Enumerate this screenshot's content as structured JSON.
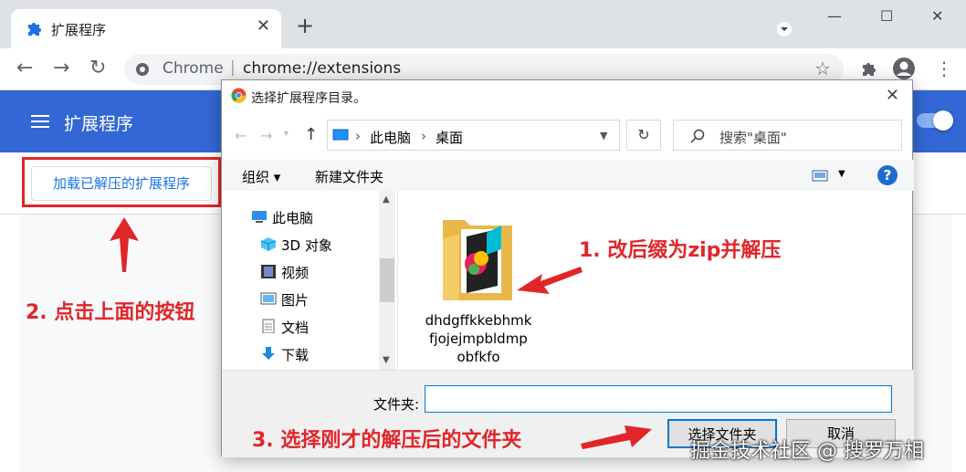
{
  "browser": {
    "tab_title": "扩展程序",
    "omnibox_site": "Chrome",
    "omnibox_url": "chrome://extensions"
  },
  "page": {
    "header_title": "扩展程序",
    "load_unpacked_label": "加载已解压的扩展程序"
  },
  "annotations": {
    "step1": "1. 改后缀为zip并解压",
    "step2": "2. 点击上面的按钮",
    "step3": "3. 选择刚才的解压后的文件夹",
    "color": "#e0262a"
  },
  "dialog": {
    "title": "选择扩展程序目录。",
    "breadcrumb": [
      "此电脑",
      "桌面"
    ],
    "search_placeholder": "搜索\"桌面\"",
    "commands": {
      "organize": "组织",
      "new_folder": "新建文件夹"
    },
    "nav_items": [
      {
        "label": "此电脑",
        "icon": "computer-icon"
      },
      {
        "label": "3D 对象",
        "icon": "cube-icon"
      },
      {
        "label": "视频",
        "icon": "film-icon"
      },
      {
        "label": "图片",
        "icon": "picture-icon"
      },
      {
        "label": "文档",
        "icon": "document-icon"
      },
      {
        "label": "下载",
        "icon": "download-arrow-icon"
      }
    ],
    "folder_name_lines": [
      "dhdgffkkebhmk",
      "fjojejmpbldmp",
      "obfkfo"
    ],
    "folder_label": "文件夹:",
    "folder_value": "",
    "select_button": "选择文件夹",
    "cancel_button": "取消"
  },
  "watermark": "掘金技术社区 @ 搜罗万相",
  "colors": {
    "header_blue": "#3367d6",
    "link_blue": "#1a73e8",
    "accent": "#0078d7"
  }
}
